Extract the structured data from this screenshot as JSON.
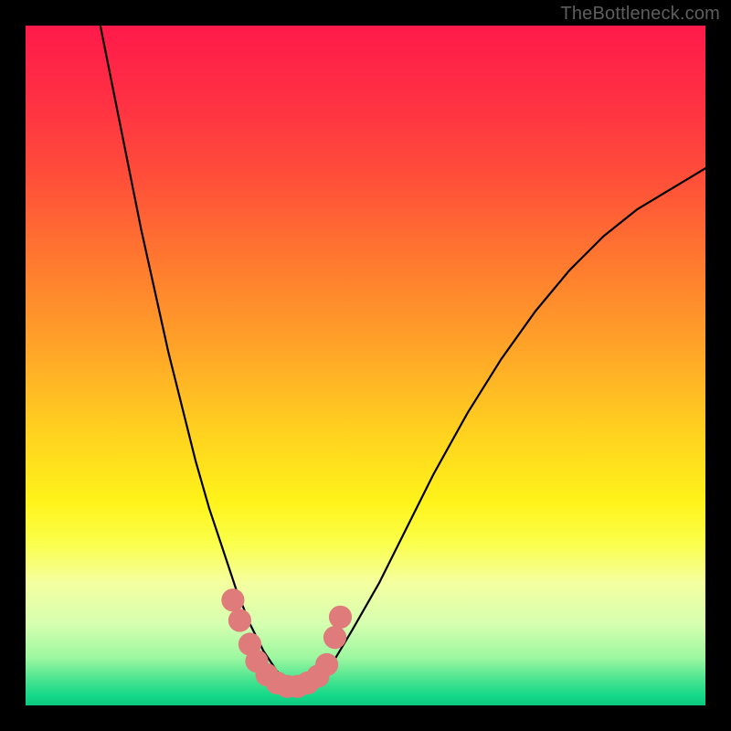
{
  "watermark": "TheBottleneck.com",
  "colors": {
    "frame": "#000000",
    "curve_stroke": "#000000",
    "marker_fill": "#df7b7b",
    "gradient_stops": [
      {
        "offset": 0.0,
        "color": "#ff1a4a"
      },
      {
        "offset": 0.1,
        "color": "#ff2e44"
      },
      {
        "offset": 0.22,
        "color": "#ff4d3a"
      },
      {
        "offset": 0.35,
        "color": "#ff7a2f"
      },
      {
        "offset": 0.48,
        "color": "#ffa628"
      },
      {
        "offset": 0.6,
        "color": "#ffd21f"
      },
      {
        "offset": 0.7,
        "color": "#fff31a"
      },
      {
        "offset": 0.76,
        "color": "#fbff4a"
      },
      {
        "offset": 0.82,
        "color": "#f4ffa0"
      },
      {
        "offset": 0.88,
        "color": "#d6ffb0"
      },
      {
        "offset": 0.93,
        "color": "#9cf7a0"
      },
      {
        "offset": 0.965,
        "color": "#42e28e"
      },
      {
        "offset": 0.985,
        "color": "#16d98a"
      },
      {
        "offset": 1.0,
        "color": "#0bc97f"
      }
    ]
  },
  "chart_data": {
    "type": "line",
    "title": "",
    "xlabel": "",
    "ylabel": "",
    "x_range": [
      0,
      100
    ],
    "y_range": [
      0,
      100
    ],
    "note": "Axes are unlabeled in the source image; x and y are normalized 0–100 estimated from pixel positions. Curve descends from top-left, bottoms out near x≈35–40, rises toward upper-right. Marker cluster sits at curve trough.",
    "series": [
      {
        "name": "curve",
        "x": [
          11,
          13,
          15,
          17,
          19,
          21,
          23,
          25,
          27,
          29,
          31,
          33,
          35,
          37,
          39,
          41,
          43,
          45,
          48,
          52,
          56,
          60,
          65,
          70,
          75,
          80,
          85,
          90,
          95,
          100
        ],
        "y": [
          100,
          90,
          80,
          70,
          61,
          52,
          44,
          36,
          29,
          23,
          17,
          12,
          8,
          5,
          3,
          2,
          3,
          6,
          11,
          18,
          26,
          34,
          43,
          51,
          58,
          64,
          69,
          73,
          76,
          79
        ]
      }
    ],
    "markers": [
      {
        "x": 30.5,
        "y": 15.5,
        "r": 1.7
      },
      {
        "x": 31.5,
        "y": 12.5,
        "r": 1.7
      },
      {
        "x": 33.0,
        "y": 9.0,
        "r": 1.7
      },
      {
        "x": 34.0,
        "y": 6.5,
        "r": 1.7
      },
      {
        "x": 35.5,
        "y": 4.5,
        "r": 1.7
      },
      {
        "x": 37.0,
        "y": 3.3,
        "r": 1.7
      },
      {
        "x": 38.5,
        "y": 2.8,
        "r": 1.7
      },
      {
        "x": 40.0,
        "y": 2.8,
        "r": 1.7
      },
      {
        "x": 41.5,
        "y": 3.3,
        "r": 1.7
      },
      {
        "x": 43.0,
        "y": 4.3,
        "r": 1.7
      },
      {
        "x": 44.3,
        "y": 6.0,
        "r": 1.7
      },
      {
        "x": 45.5,
        "y": 10.0,
        "r": 1.7
      },
      {
        "x": 46.3,
        "y": 13.0,
        "r": 1.7
      }
    ]
  }
}
